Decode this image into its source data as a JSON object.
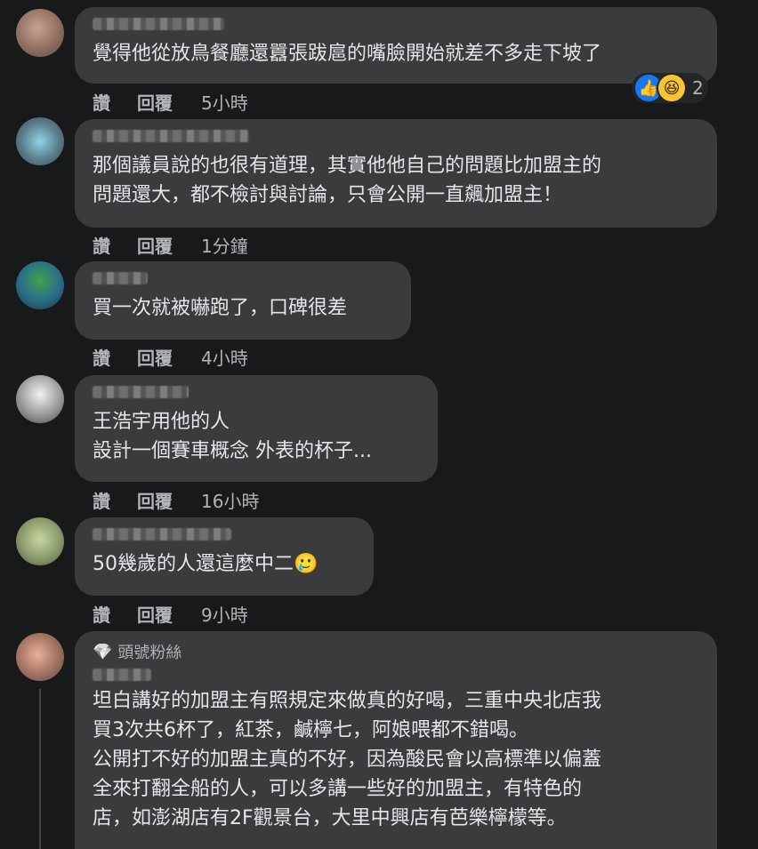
{
  "comments": [
    {
      "text": "覺得他從放鳥餐廳還囂張跋扈的嘴臉開始就差不多走下坡了",
      "like": "讚",
      "reply": "回覆",
      "time": "5小時",
      "reactions": {
        "count": "2"
      }
    },
    {
      "text": "那個議員說的也很有道理，其實他他自己的問題比加盟主的\n問題還大，都不檢討與討論，只會公開一直飆加盟主！",
      "like": "讚",
      "reply": "回覆",
      "time": "1分鐘"
    },
    {
      "text": "買一次就被嚇跑了，口碑很差",
      "like": "讚",
      "reply": "回覆",
      "time": "4小時"
    },
    {
      "text": "王浩宇用他的人\n設計一個賽車概念 外表的杯子...",
      "like": "讚",
      "reply": "回覆",
      "time": "16小時"
    },
    {
      "text": "50幾歲的人還這麼中二🥲",
      "like": "讚",
      "reply": "回覆",
      "time": "9小時"
    },
    {
      "badge": "頭號粉絲",
      "text": "坦白講好的加盟主有照規定來做真的好喝，三重中央北店我\n買3次共6杯了，紅茶，鹹檸七，阿娘喂都不錯喝。\n公開打不好的加盟主真的不好，因為酸民會以高標準以偏蓋\n全來打翻全船的人，可以多講一些好的加盟主，有特色的\n店，如澎湖店有2F觀景台，大里中興店有芭樂檸檬等。"
    }
  ],
  "icons": {
    "like": "👍",
    "haha": "😆",
    "badge": "💎"
  },
  "colors": {
    "background": "#18191a",
    "bubble": "#3a3b3c",
    "text": "#e4e6eb",
    "muted": "#b0b3b8",
    "like_blue": "#1877f2"
  }
}
